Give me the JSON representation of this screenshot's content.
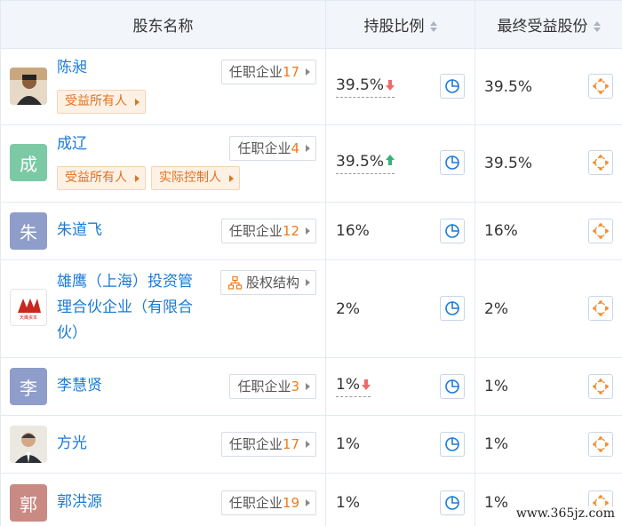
{
  "header": {
    "col_name": "股东名称",
    "col_ratio": "持股比例",
    "col_final": "最终受益股份"
  },
  "colors": {
    "link": "#1a7ad8",
    "count": "#f07a18",
    "tag_text": "#e2711d",
    "arrow_down": "#f06a6a",
    "arrow_up": "#34b27a",
    "icon": "#1a7ad8",
    "target_icon": "#f58a2c"
  },
  "rows": [
    {
      "name": "陈昶",
      "avatar": "photo-man",
      "job_label": "任职企业",
      "job_count": "17",
      "tags": [
        "受益所有人"
      ],
      "ratio": "39.5%",
      "trend": "down",
      "final": "39.5%"
    },
    {
      "name": "成辽",
      "avatar_char": "成",
      "avatar_color": "#7cc9a6",
      "job_label": "任职企业",
      "job_count": "4",
      "tags": [
        "受益所有人",
        "实际控制人"
      ],
      "ratio": "39.5%",
      "trend": "up",
      "final": "39.5%"
    },
    {
      "name": "朱道飞",
      "avatar_char": "朱",
      "avatar_color": "#8e9dc9",
      "job_label": "任职企业",
      "job_count": "12",
      "tags": [],
      "ratio": "16%",
      "final": "16%"
    },
    {
      "name_lines": [
        "雄鹰（上海）投资管",
        "理合伙企业（有限合",
        "伙）"
      ],
      "avatar": "logo-company",
      "logo_text": "天鹰资本",
      "equity_label": "股权结构",
      "tags": [],
      "ratio": "2%",
      "final": "2%"
    },
    {
      "name": "李慧贤",
      "avatar_char": "李",
      "avatar_color": "#8e9dc9",
      "job_label": "任职企业",
      "job_count": "3",
      "tags": [],
      "ratio": "1%",
      "trend": "down",
      "final": "1%"
    },
    {
      "name": "方光",
      "avatar": "photo-man-suit",
      "job_label": "任职企业",
      "job_count": "17",
      "tags": [],
      "ratio": "1%",
      "final": "1%"
    },
    {
      "name": "郭洪源",
      "avatar_char": "郭",
      "avatar_color": "#c98a84",
      "job_label": "任职企业",
      "job_count": "19",
      "tags": [],
      "ratio": "1%",
      "final": "1%"
    }
  ],
  "watermark": "www.365jz.com"
}
